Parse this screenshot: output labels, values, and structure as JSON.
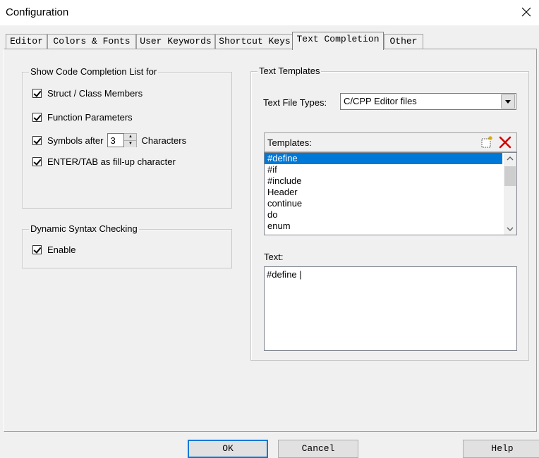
{
  "window": {
    "title": "Configuration"
  },
  "tabs": [
    {
      "label": "Editor"
    },
    {
      "label": "Colors & Fonts"
    },
    {
      "label": "User Keywords"
    },
    {
      "label": "Shortcut Keys"
    },
    {
      "label": "Text Completion",
      "active": true
    },
    {
      "label": "Other"
    }
  ],
  "code_completion": {
    "title": "Show Code Completion List for",
    "struct_members": {
      "label": "Struct / Class Members",
      "checked": true
    },
    "function_params": {
      "label": "Function Parameters",
      "checked": true
    },
    "symbols_after": {
      "label_before": "Symbols after",
      "value": "3",
      "label_after": "Characters",
      "checked": true
    },
    "enter_tab": {
      "label": "ENTER/TAB as fill-up character",
      "checked": true
    }
  },
  "syntax_checking": {
    "title": "Dynamic Syntax Checking",
    "enable": {
      "label": "Enable",
      "checked": true
    }
  },
  "text_templates": {
    "title": "Text Templates",
    "file_types_label": "Text File Types:",
    "file_types_value": "C/CPP Editor files",
    "templates_label": "Templates:",
    "templates": [
      "#define",
      "#if",
      "#include",
      "Header",
      "continue",
      "do",
      "enum"
    ],
    "selected_index": 0,
    "text_label": "Text:",
    "text_value": "#define |"
  },
  "buttons": {
    "ok": "OK",
    "cancel": "Cancel",
    "help": "Help"
  },
  "colors": {
    "selection": "#0078d7",
    "delete_icon": "#d40000"
  }
}
